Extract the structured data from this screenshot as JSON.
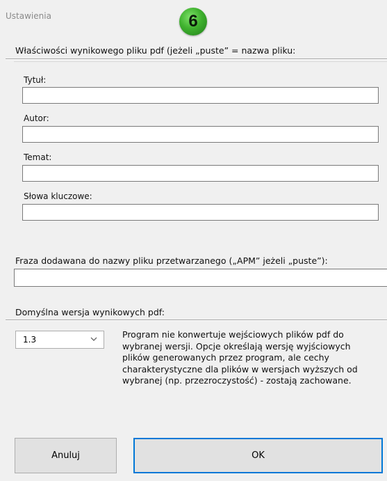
{
  "window": {
    "title": "Ustawienia"
  },
  "badge": {
    "number": "6",
    "color": "#3fb12e"
  },
  "pdf_properties": {
    "section_title": "Właściwości wynikowego pliku pdf (jeżeli „puste” = nazwa pliku:",
    "fields": [
      {
        "label": "Tytuł:",
        "value": ""
      },
      {
        "label": "Autor:",
        "value": ""
      },
      {
        "label": "Temat:",
        "value": ""
      },
      {
        "label": "Słowa kluczowe:",
        "value": ""
      }
    ]
  },
  "suffix": {
    "label": "Fraza dodawana do nazwy pliku przetwarzanego („APM” jeżeli „puste”):",
    "value": ""
  },
  "version": {
    "section_title": "Domyślna wersja wynikowych pdf:",
    "selected": "1.3",
    "chevron_icon": "chevron-down-icon",
    "description": "Program nie konwertuje wejściowych plików pdf do wybranej wersji. Opcje określają wersję wyjściowych plików generowanych przez program, ale cechy charakterystyczne dla plików w wersjach wyższych od wybranej (np. przezroczystość) - zostają zachowane."
  },
  "buttons": {
    "cancel_label": "Anuluj",
    "ok_label": "OK"
  },
  "colors": {
    "accent": "#0078d7",
    "background": "#f0f0f0"
  }
}
